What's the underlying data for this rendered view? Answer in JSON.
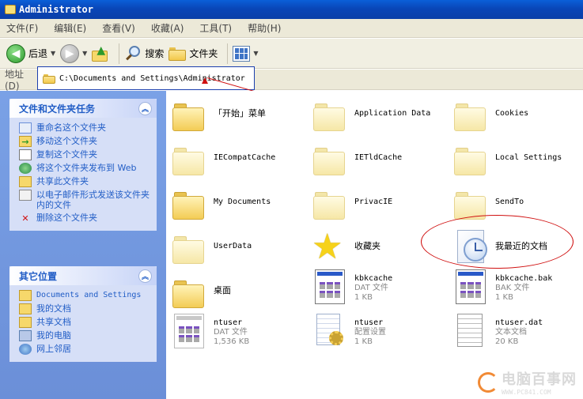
{
  "window": {
    "title": "Administrator"
  },
  "menu": [
    "文件(F)",
    "编辑(E)",
    "查看(V)",
    "收藏(A)",
    "工具(T)",
    "帮助(H)"
  ],
  "toolbar": {
    "back_label": "后退",
    "search_label": "搜索",
    "folders_label": "文件夹"
  },
  "address": {
    "label": "地址(D)",
    "path": "C:\\Documents and Settings\\Administrator"
  },
  "tasks_panel": {
    "title": "文件和文件夹任务",
    "items": [
      {
        "label": "重命名这个文件夹",
        "icon": "rename-icon"
      },
      {
        "label": "移动这个文件夹",
        "icon": "move-icon"
      },
      {
        "label": "复制这个文件夹",
        "icon": "copy-icon"
      },
      {
        "label": "将这个文件夹发布到 Web",
        "icon": "publish-web-icon"
      },
      {
        "label": "共享此文件夹",
        "icon": "share-icon"
      },
      {
        "label": "以电子邮件形式发送该文件夹内的文件",
        "icon": "email-icon"
      },
      {
        "label": "删除这个文件夹",
        "icon": "delete-icon"
      }
    ]
  },
  "places_panel": {
    "title": "其它位置",
    "items": [
      {
        "label": "Documents and Settings",
        "icon": "folder-icon"
      },
      {
        "label": "我的文档",
        "icon": "my-documents-icon"
      },
      {
        "label": "共享文档",
        "icon": "shared-documents-icon"
      },
      {
        "label": "我的电脑",
        "icon": "my-computer-icon"
      },
      {
        "label": "网上邻居",
        "icon": "network-icon"
      }
    ]
  },
  "files": [
    {
      "name": "「开始」菜单",
      "icon": "folder-icon"
    },
    {
      "name": "Application Data",
      "icon": "folder-icon"
    },
    {
      "name": "Cookies",
      "icon": "folder-icon"
    },
    {
      "name": "IECompatCache",
      "icon": "folder-icon"
    },
    {
      "name": "IETldCache",
      "icon": "folder-icon"
    },
    {
      "name": "Local Settings",
      "icon": "folder-icon"
    },
    {
      "name": "My Documents",
      "icon": "folder-icon"
    },
    {
      "name": "PrivacIE",
      "icon": "folder-icon"
    },
    {
      "name": "SendTo",
      "icon": "folder-icon"
    },
    {
      "name": "UserData",
      "icon": "folder-icon"
    },
    {
      "name": "收藏夹",
      "icon": "favorites-star-icon"
    },
    {
      "name": "我最近的文档",
      "icon": "recent-documents-icon"
    },
    {
      "name": "桌面",
      "icon": "folder-icon"
    },
    {
      "name": "kbkcache",
      "type": "DAT 文件",
      "size": "1 KB",
      "icon": "dat-file-icon"
    },
    {
      "name": "kbkcache.bak",
      "type": "BAK 文件",
      "size": "1 KB",
      "icon": "bak-file-icon"
    },
    {
      "name": "ntuser",
      "type": "DAT 文件",
      "size": "1,536 KB",
      "icon": "dat-file-icon"
    },
    {
      "name": "ntuser",
      "type": "配置设置",
      "size": "1 KB",
      "icon": "config-file-icon"
    },
    {
      "name": "ntuser.dat",
      "type": "文本文档",
      "size": "20 KB",
      "icon": "text-file-icon"
    }
  ],
  "watermark": {
    "main": "电脑百事网",
    "sub": "WWW.PC841.COM"
  }
}
